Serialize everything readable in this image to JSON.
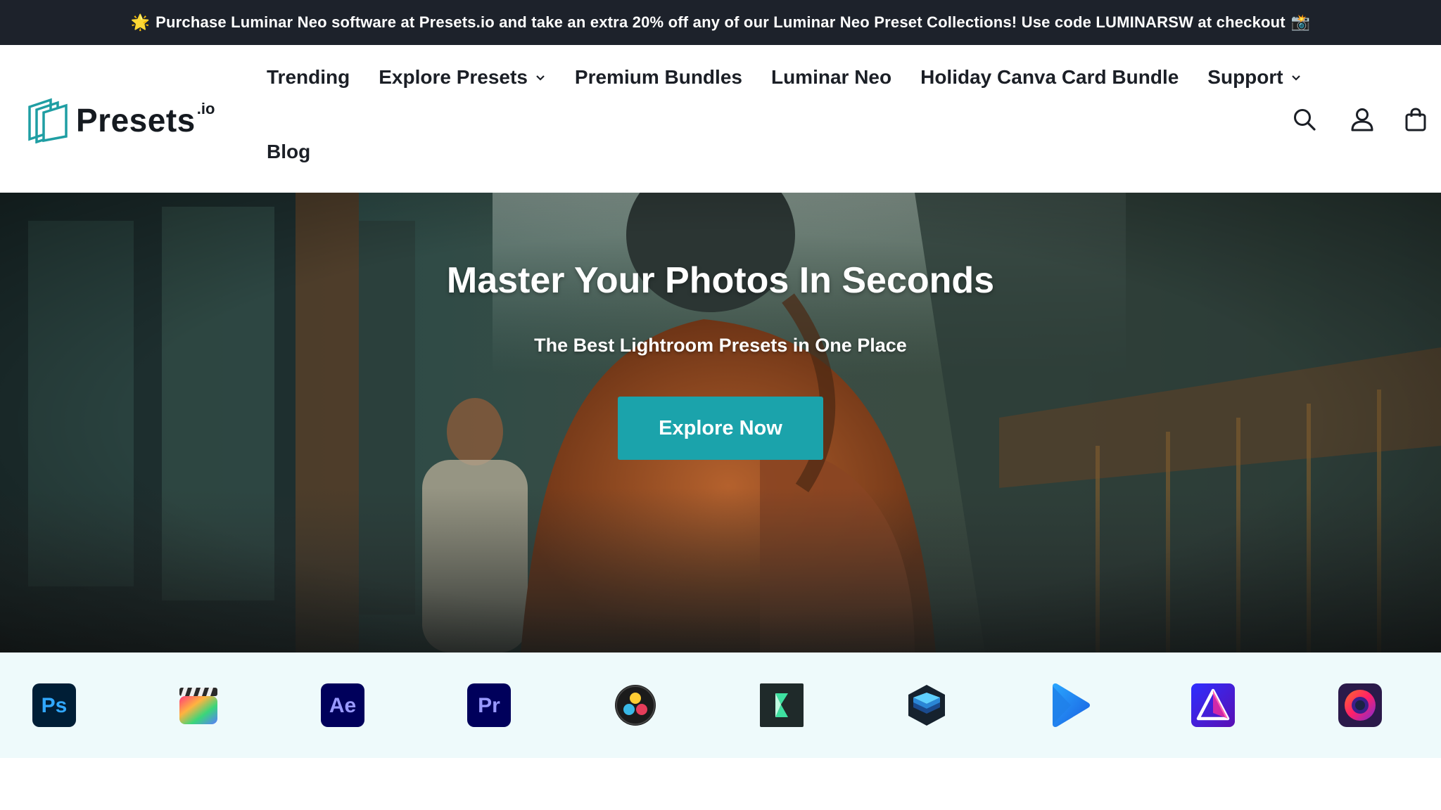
{
  "announcement": {
    "lead_emoji": "🌟",
    "text": "Purchase Luminar Neo software at Presets.io and take an extra 20% off any of our Luminar Neo Preset Collections! Use code LUMINARSW at checkout",
    "trail_emoji": "📸"
  },
  "header": {
    "logo_text": "Presets",
    "logo_suffix": ".io",
    "nav": [
      {
        "label": "Trending"
      },
      {
        "label": "Explore Presets",
        "has_dropdown": true
      },
      {
        "label": "Premium Bundles"
      },
      {
        "label": "Luminar Neo"
      },
      {
        "label": "Holiday Canva Card Bundle"
      },
      {
        "label": "Support",
        "has_dropdown": true
      },
      {
        "label": "Blog"
      }
    ],
    "icons": [
      "search-icon",
      "account-icon",
      "cart-icon"
    ]
  },
  "hero": {
    "title": "Master Your Photos In Seconds",
    "subtitle": "The Best Lightroom Presets in One Place",
    "cta_label": "Explore Now"
  },
  "apps": {
    "items": [
      {
        "name": "photoshop-icon",
        "abbr": "Ps"
      },
      {
        "name": "final-cut-pro-icon"
      },
      {
        "name": "after-effects-icon",
        "abbr": "Ae"
      },
      {
        "name": "premiere-pro-icon",
        "abbr": "Pr"
      },
      {
        "name": "davinci-resolve-icon"
      },
      {
        "name": "filmora-icon"
      },
      {
        "name": "layers-app-icon"
      },
      {
        "name": "play-video-icon"
      },
      {
        "name": "luminar-icon"
      },
      {
        "name": "capture-one-icon"
      }
    ]
  },
  "colors": {
    "announcement_bg": "#1d222b",
    "cta": "#1ba3ab",
    "logo_teal": "#1f9ea3",
    "apps_bg": "#eefafb"
  }
}
